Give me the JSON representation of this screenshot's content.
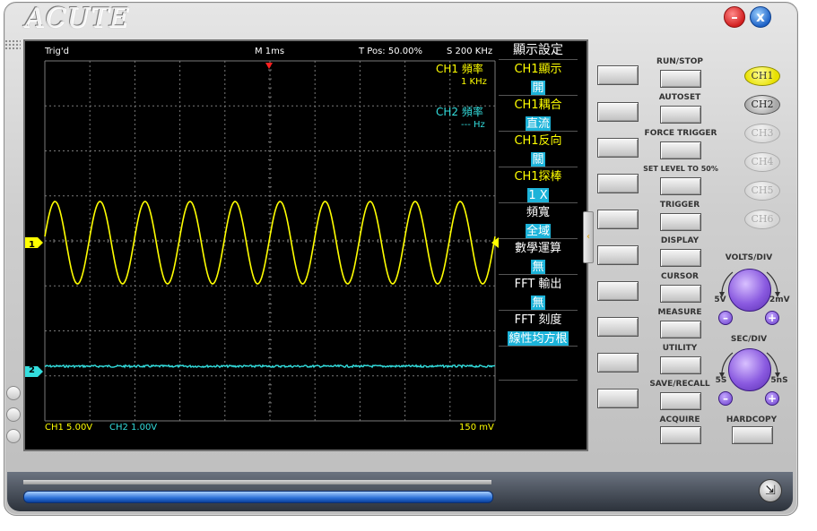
{
  "app": {
    "logo": "ACUTE"
  },
  "window": {
    "minimize_label": "–",
    "close_label": "x"
  },
  "scope": {
    "status": "Trig'd",
    "time_base": "M 1ms",
    "trigger_pos": "T Pos: 50.00%",
    "sample_rate": "S 200 KHz",
    "ch1_freq_label": "CH1 頻率",
    "ch1_freq_value": "1 KHz",
    "ch2_freq_label": "CH2 頻率",
    "ch2_freq_value": "--- Hz",
    "ch1_scale": "CH1  5.00V",
    "ch2_scale": "CH2  1.00V",
    "trigger_level": "150 mV",
    "ch1_marker": "1",
    "ch2_marker": "2",
    "colors": {
      "ch1": "#ffff00",
      "ch2": "#33dddd",
      "grid": "#7a7a7a",
      "trigger_marker": "#ff2020"
    }
  },
  "menu": {
    "title": "顯示設定",
    "items": [
      {
        "label": "CH1顯示",
        "value": "開"
      },
      {
        "label": "CH1耦合",
        "value": "直流"
      },
      {
        "label": "CH1反向",
        "value": "關"
      },
      {
        "label": "CH1探棒",
        "value": "1 X"
      },
      {
        "label": "頻寬",
        "value": "全域"
      },
      {
        "label": "數學運算",
        "value": "無"
      },
      {
        "label": "FFT 輸出",
        "value": "無"
      },
      {
        "label": "FFT 刻度",
        "value": "線性均方根"
      }
    ]
  },
  "controls": {
    "run_stop": "RUN/STOP",
    "autoset": "AUTOSET",
    "force_trigger": "FORCE TRIGGER",
    "set_level": "SET LEVEL TO 50%",
    "trigger": "TRIGGER",
    "display": "DISPLAY",
    "cursor": "CURSOR",
    "measure": "MEASURE",
    "utility": "UTILITY",
    "save_recall": "SAVE/RECALL",
    "acquire": "ACQUIRE",
    "hardcopy": "HARDCOPY"
  },
  "channels": [
    "CH1",
    "CH2",
    "CH3",
    "CH4",
    "CH5",
    "CH6"
  ],
  "volts_div": {
    "title": "VOLTS/DIV",
    "min": "5V",
    "max": "2mV",
    "minus": "–",
    "plus": "+"
  },
  "sec_div": {
    "title": "SEC/DIV",
    "min": "5S",
    "max": "5nS",
    "minus": "–",
    "plus": "+"
  },
  "icons": {
    "corner": "resize-icon"
  }
}
